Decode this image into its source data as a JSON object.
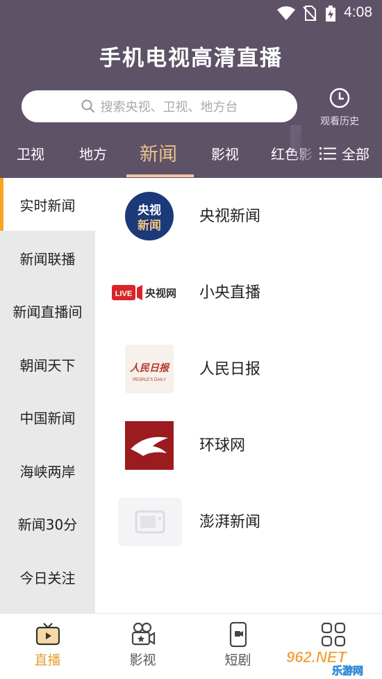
{
  "status": {
    "time": "4:08"
  },
  "app": {
    "title": "手机电视高清直播"
  },
  "search": {
    "placeholder": "搜索央视、卫视、地方台"
  },
  "history": {
    "label": "观看历史"
  },
  "categories": [
    {
      "label": "卫视"
    },
    {
      "label": "地方"
    },
    {
      "label": "新闻",
      "active": true
    },
    {
      "label": "影视"
    },
    {
      "label": "红色影"
    }
  ],
  "all_label": "全部",
  "sidebar": [
    {
      "label": "实时新闻",
      "active": true
    },
    {
      "label": "新闻联播"
    },
    {
      "label": "新闻直播间"
    },
    {
      "label": "朝闻天下"
    },
    {
      "label": "中国新闻"
    },
    {
      "label": "海峡两岸"
    },
    {
      "label": "新闻30分"
    },
    {
      "label": "今日关注"
    }
  ],
  "channels": [
    {
      "title": "央视新闻",
      "logo_text": [
        "央视",
        "新闻"
      ]
    },
    {
      "title": "小央直播",
      "logo_text": [
        "LIVE",
        "央视网"
      ]
    },
    {
      "title": "人民日报",
      "logo_text": [
        "人民日报",
        "PEOPLE'S DAILY"
      ]
    },
    {
      "title": "环球网"
    },
    {
      "title": "澎湃新闻"
    }
  ],
  "tabs": [
    {
      "label": "直播",
      "active": true
    },
    {
      "label": "影视"
    },
    {
      "label": "短剧"
    },
    {
      "label": ""
    }
  ],
  "watermark": {
    "top": "962.NET",
    "bottom": "乐游网"
  },
  "colors": {
    "header": "#5e5267",
    "accent": "#e3a23b",
    "tab_active": "#e9c28f",
    "sidebar_bg": "#e9e9e9"
  }
}
